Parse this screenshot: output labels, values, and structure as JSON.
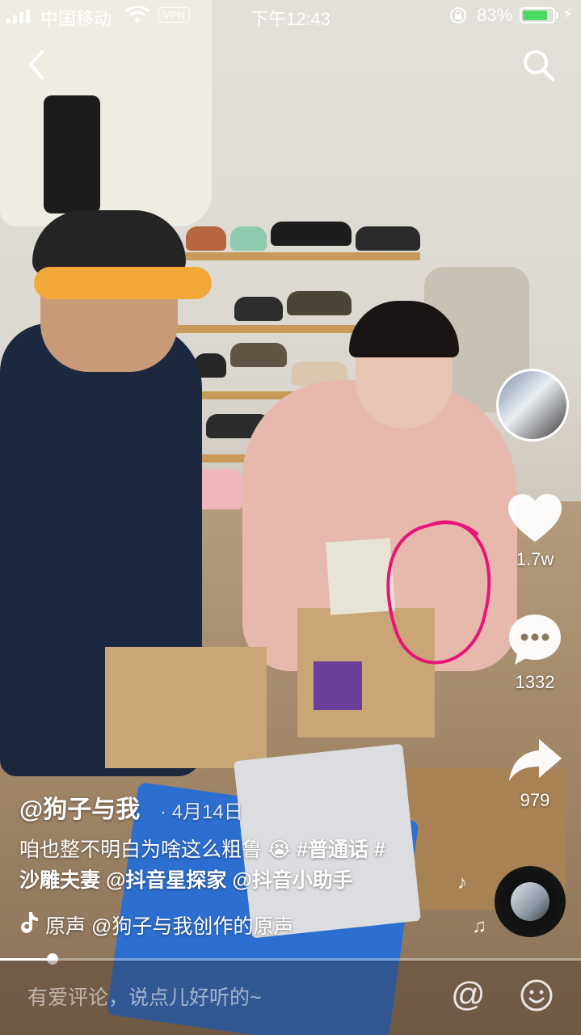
{
  "status_bar": {
    "carrier": "中国移动",
    "vpn": "VPN",
    "time": "下午12:43",
    "battery_percent": "83%",
    "battery_level": 0.83
  },
  "video": {
    "author": "@狗子与我",
    "date": "· 4月14日",
    "caption_text": "咱也整不明白为啥这么粗鲁 😭",
    "caption_tag_1": "#普通话",
    "caption_tag_2": "#",
    "caption_line2_text": "沙雕夫妻",
    "caption_mention_1": "@抖音星探家",
    "caption_mention_2": "@抖音小助手",
    "music": "原声    @狗子与我创作的原声",
    "progress": 0.09
  },
  "actions": {
    "likes": "1.7w",
    "comments": "1332",
    "shares": "979"
  },
  "comment_bar": {
    "placeholder": "有爱评论，说点儿好听的~",
    "at_symbol": "@"
  }
}
